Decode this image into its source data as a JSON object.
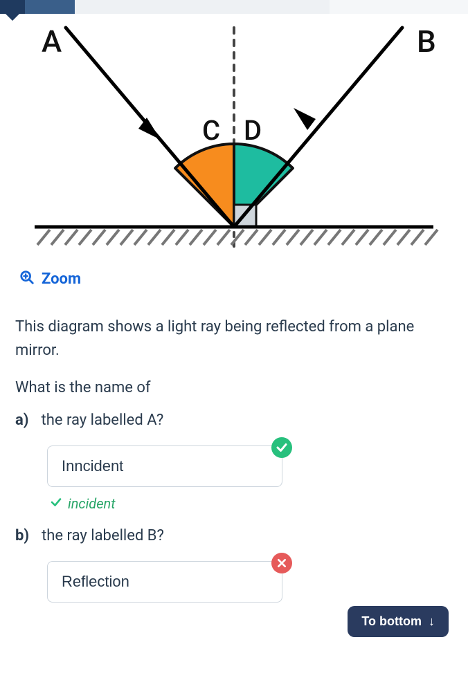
{
  "diagram": {
    "labels": {
      "A": "A",
      "B": "B",
      "C": "C",
      "D": "D"
    },
    "colors": {
      "C_fill": "#f78c1e",
      "D_fill": "#1ebca0"
    }
  },
  "zoom": {
    "label": "Zoom"
  },
  "intro": "This diagram shows a light ray being reflected from a plane mirror.",
  "lead_in": "What is the name of",
  "parts": {
    "a": {
      "letter": "a)",
      "question": "the ray labelled A?",
      "answer_value": "Inncident",
      "status": "correct",
      "feedback": "incident"
    },
    "b": {
      "letter": "b)",
      "question": "the ray labelled B?",
      "answer_value": "Reflection",
      "status": "wrong"
    }
  },
  "to_bottom": {
    "label": "To bottom",
    "arrow": "↓"
  }
}
